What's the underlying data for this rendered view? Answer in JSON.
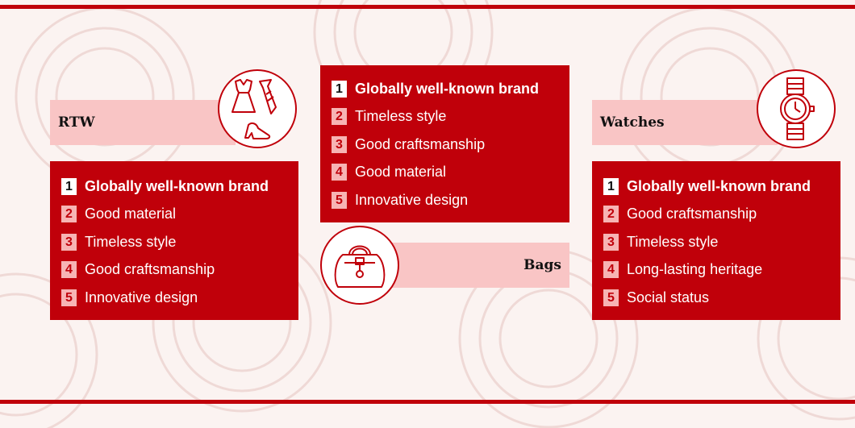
{
  "colors": {
    "accent": "#c0000a",
    "band": "#f9c5c5",
    "number_badge": "#f7b4b4",
    "background": "#fbf3f1"
  },
  "categories": [
    {
      "label": "RTW",
      "icon": "clothing-icon",
      "items": [
        {
          "num": "1",
          "text": "Globally well-known brand"
        },
        {
          "num": "2",
          "text": "Good material"
        },
        {
          "num": "3",
          "text": "Timeless style"
        },
        {
          "num": "4",
          "text": "Good craftsmanship"
        },
        {
          "num": "5",
          "text": "Innovative design"
        }
      ]
    },
    {
      "label": "Bags",
      "icon": "handbag-icon",
      "items": [
        {
          "num": "1",
          "text": "Globally well-known brand"
        },
        {
          "num": "2",
          "text": "Timeless style"
        },
        {
          "num": "3",
          "text": "Good craftsmanship"
        },
        {
          "num": "4",
          "text": "Good material"
        },
        {
          "num": "5",
          "text": "Innovative design"
        }
      ]
    },
    {
      "label": "Watches",
      "icon": "wristwatch-icon",
      "items": [
        {
          "num": "1",
          "text": "Globally well-known brand"
        },
        {
          "num": "2",
          "text": "Good craftsmanship"
        },
        {
          "num": "3",
          "text": "Timeless style"
        },
        {
          "num": "4",
          "text": "Long-lasting heritage"
        },
        {
          "num": "5",
          "text": "Social status"
        }
      ]
    }
  ]
}
